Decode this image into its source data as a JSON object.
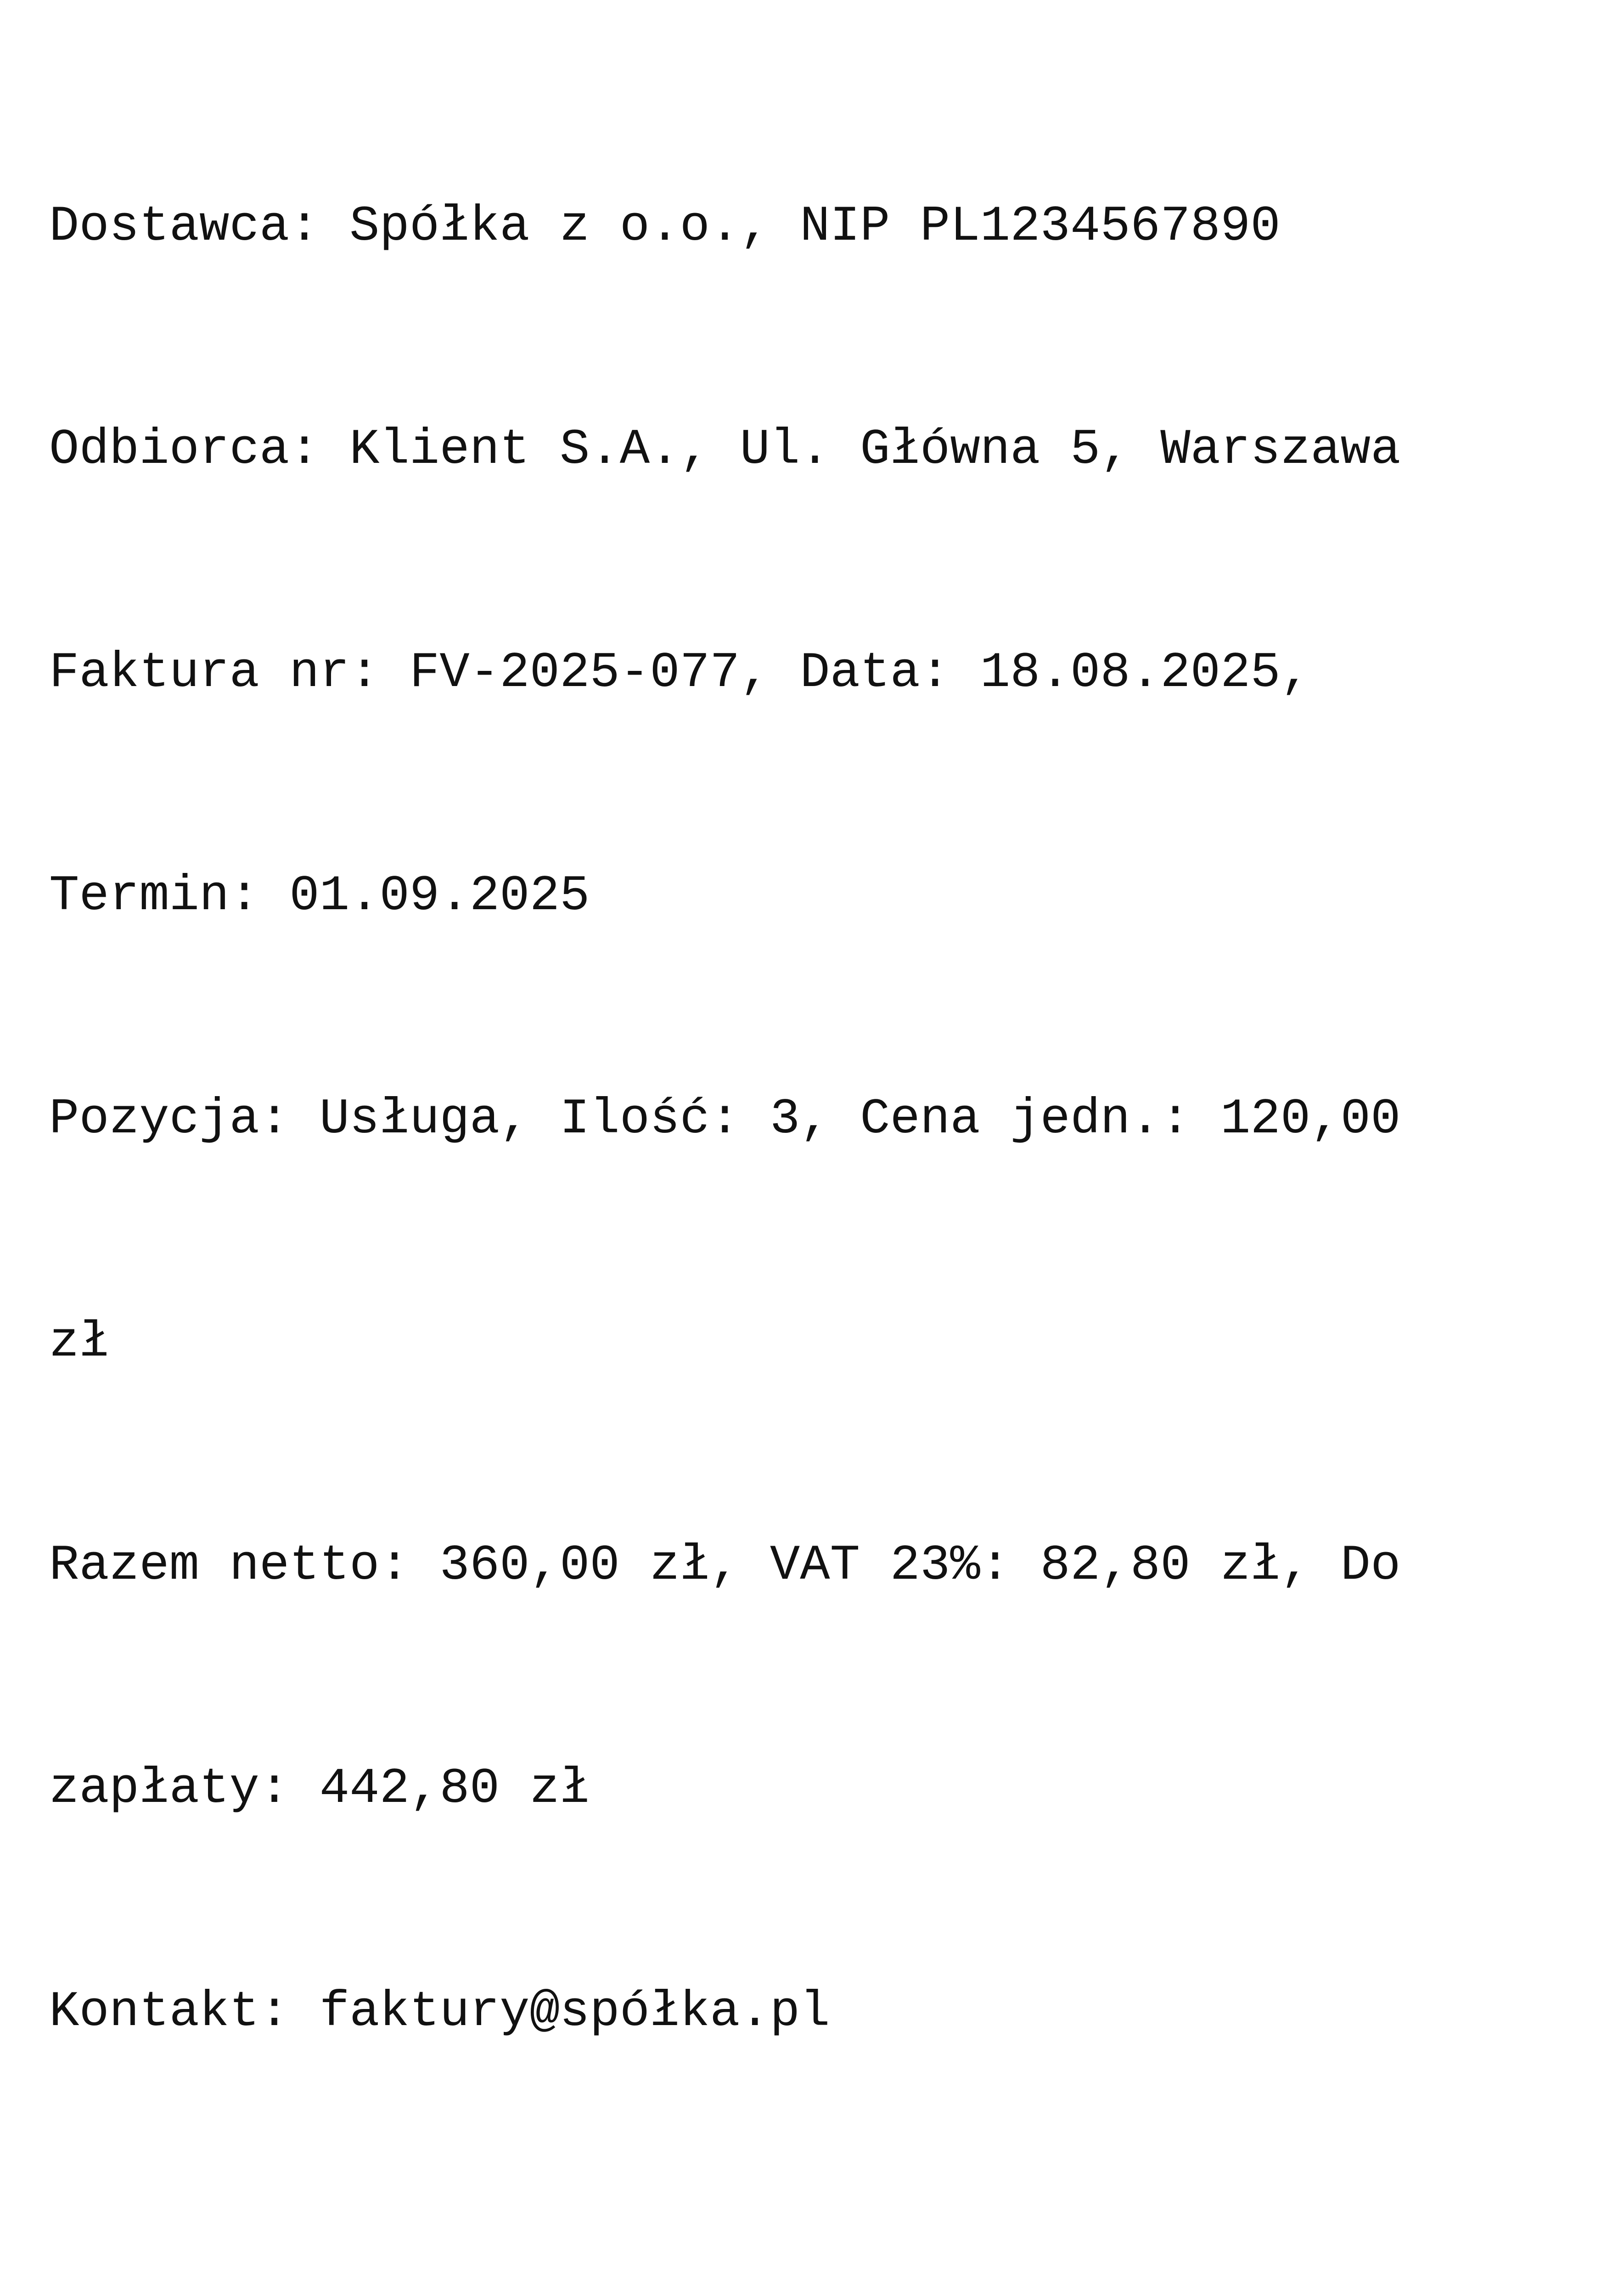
{
  "document": {
    "lines": [
      "Dostawca: Spółka z o.o., NIP PL1234567890",
      "Odbiorca: Klient S.A., Ul. Główna 5, Warszawa",
      "Faktura nr: FV-2025-077, Data: 18.08.2025,",
      "Termin: 01.09.2025",
      "Pozycja: Usługa, Ilość: 3, Cena jedn.: 120,00",
      "zł",
      "Razem netto: 360,00 zł, VAT 23%: 82,80 zł, Do",
      "zapłaty: 442,80 zł",
      "Kontakt: faktury@spółka.pl"
    ]
  }
}
